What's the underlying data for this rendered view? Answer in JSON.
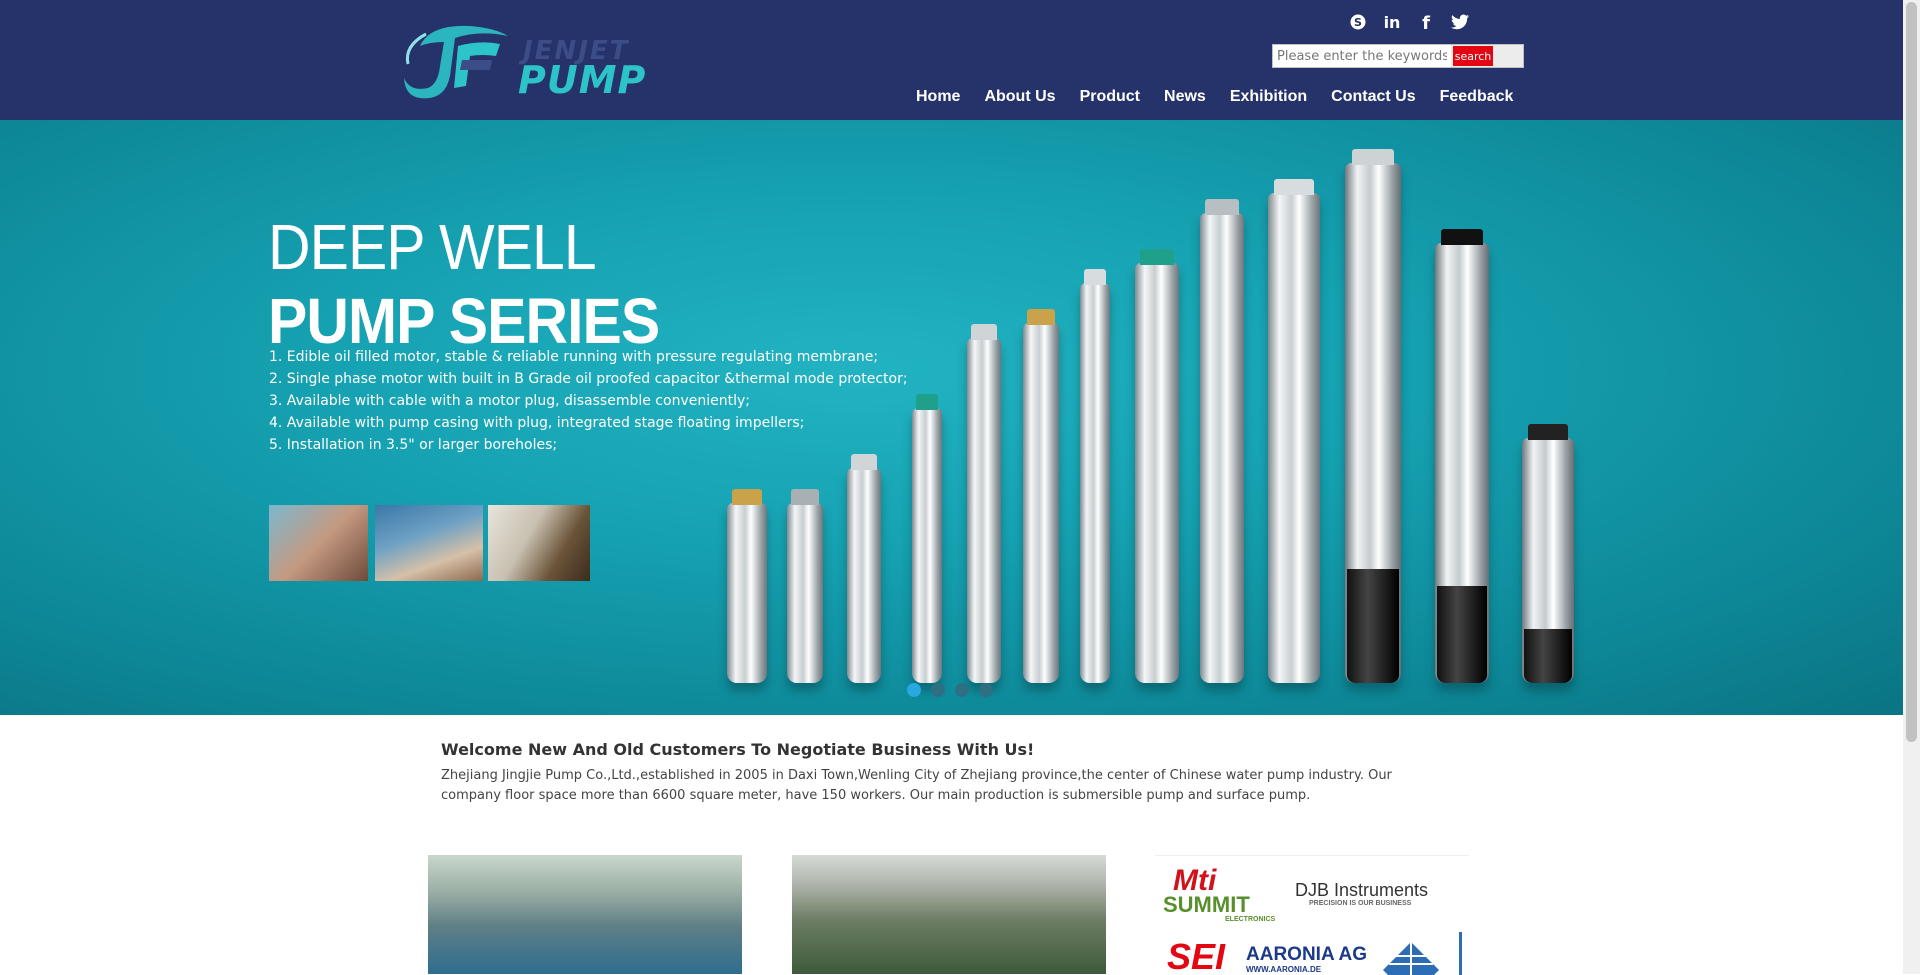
{
  "brand": {
    "logo_top_text": "JENJET",
    "logo_main_text": "PUMP",
    "colors": {
      "header_bg": "#26336a",
      "accent": "#2cc4c9",
      "search_button": "#e30613"
    }
  },
  "social": {
    "icons": [
      "skype-icon",
      "linkedin-icon",
      "facebook-icon",
      "twitter-icon"
    ]
  },
  "search": {
    "placeholder": "Please enter the keywords",
    "button_label": "search"
  },
  "nav": {
    "items": [
      {
        "label": "Home"
      },
      {
        "label": "About Us"
      },
      {
        "label": "Product"
      },
      {
        "label": "News"
      },
      {
        "label": "Exhibition"
      },
      {
        "label": "Contact Us"
      },
      {
        "label": "Feedback"
      }
    ]
  },
  "banner": {
    "title_line1": "DEEP WELL",
    "title_line2": "PUMP SERIES",
    "features": [
      "1. Edible oil filled motor, stable  & reliable running with pressure regulating membrane;",
      "2. Single phase  motor with built in B  Grade oil proofed capacitor &thermal mode  protector;",
      "3. Available with cable with  a motor plug,  disassemble conveniently;",
      "4. Available with pump  casing with plug, integrated  stage floating impellers;",
      "5. Installation in 3.5\"  or larger boreholes;"
    ],
    "slides_total": 4,
    "slide_active": 1
  },
  "welcome": {
    "title": "Welcome New And Old Customers To Negotiate Business With Us!",
    "text": "Zhejiang Jingjie Pump Co.,Ltd.,established in 2005 in Daxi Town,Wenling City of Zhejiang province,the center of Chinese water pump industry. Our company floor space more than 6600 square meter, have 150 workers. Our main production is submersible pump and surface pump."
  },
  "partners": {
    "mti": "Mti",
    "summit": "SUMMIT",
    "summit_sub": "ELECTRONICS",
    "djb": "DJB Instruments",
    "djb_sub": "PRECISION IS OUR BUSINESS",
    "sei": "SEI",
    "aaronia": "AARONIA AG",
    "aaronia_sub": "WWW.AARONIA.DE"
  }
}
